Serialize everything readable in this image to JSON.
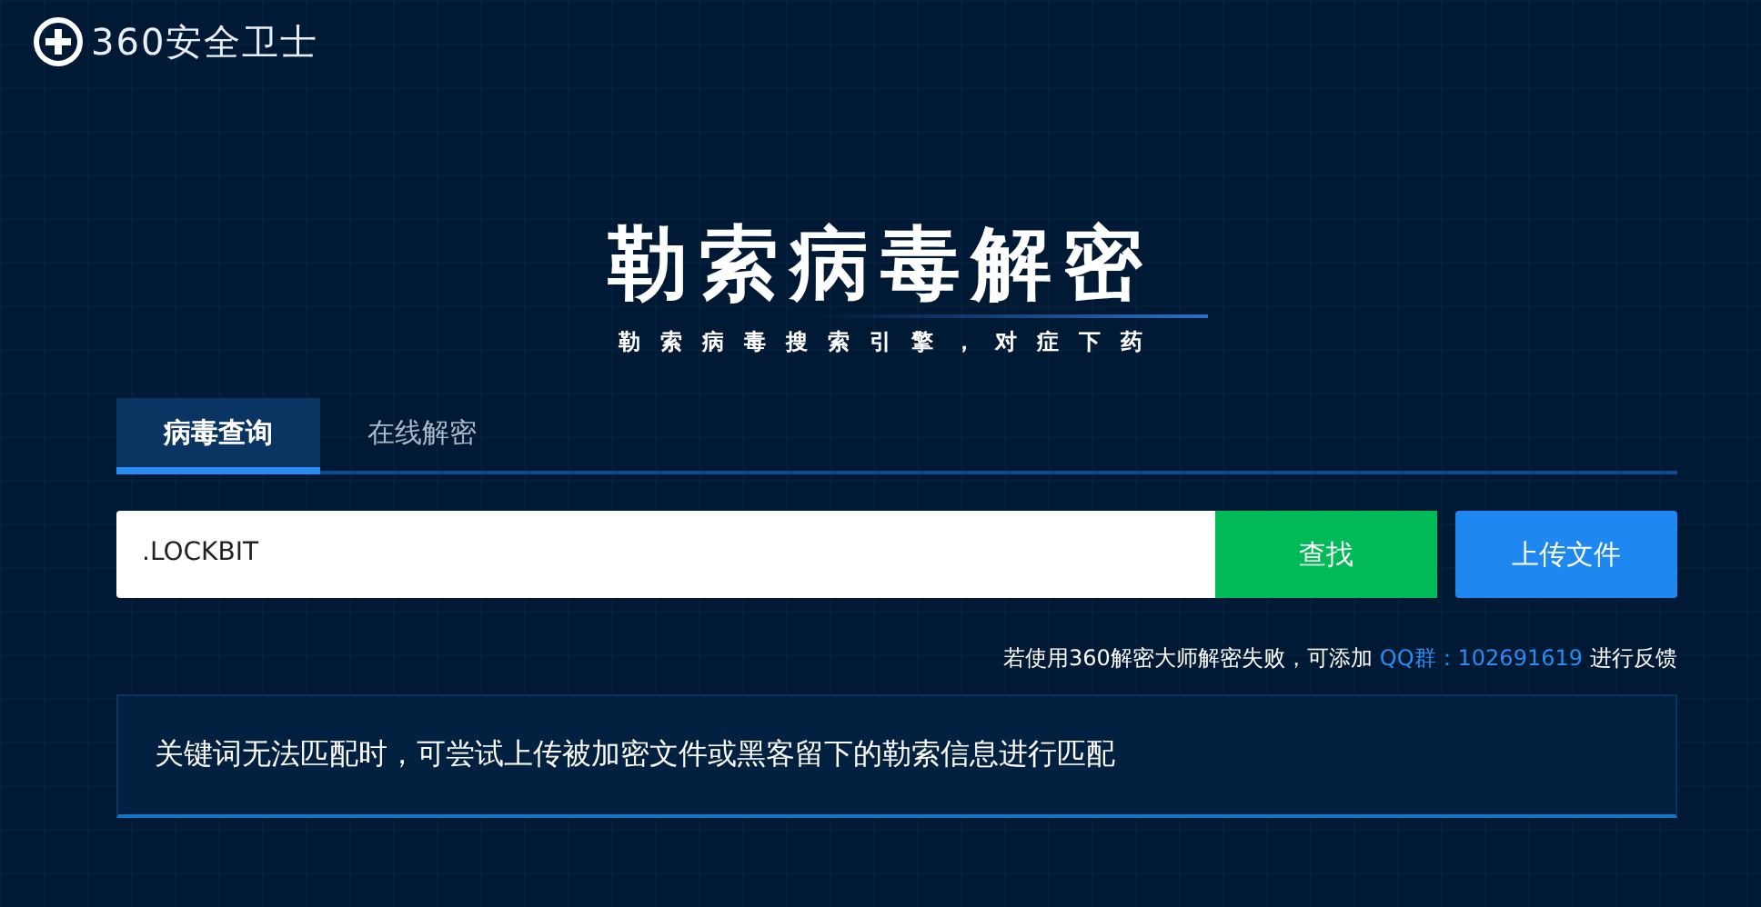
{
  "logo": {
    "text": "360安全卫士"
  },
  "hero": {
    "title": "勒索病毒解密",
    "subtitle": "勒索病毒搜索引擎，对症下药"
  },
  "tabs": [
    {
      "label": "病毒查询",
      "selected": true
    },
    {
      "label": "在线解密",
      "selected": false
    }
  ],
  "search": {
    "value": ".LOCKBIT",
    "button": "查找",
    "upload": "上传文件"
  },
  "note": {
    "text": "若使用360解密大师解密失败，可添加",
    "link": "QQ群：102691619",
    "suffix": "进行反馈"
  },
  "info": {
    "text": "关键词无法匹配时，可尝试上传被加密文件或黑客留下的勒索信息进行匹配"
  }
}
